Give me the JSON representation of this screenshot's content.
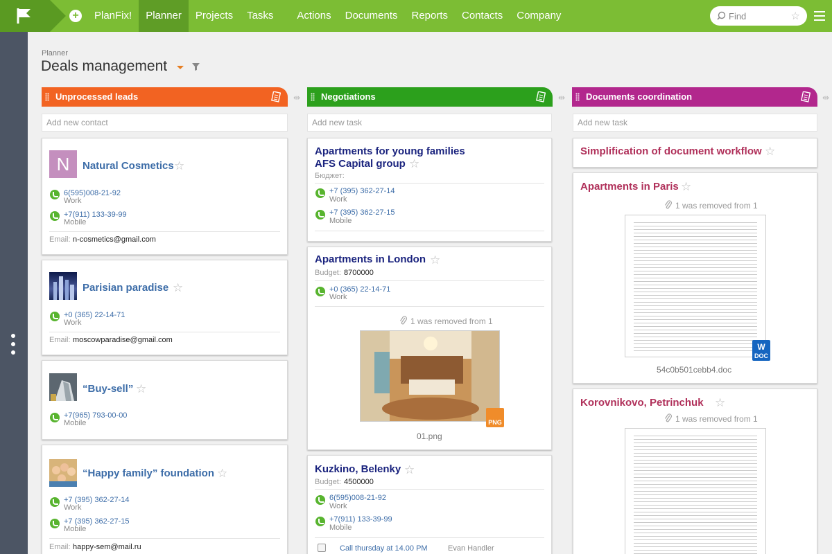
{
  "app": {
    "name": "PlanFix!"
  },
  "nav": [
    "Planner",
    "Projects",
    "Tasks",
    "Actions",
    "Documents",
    "Reports",
    "Contacts",
    "Company"
  ],
  "search": {
    "placeholder": "Find"
  },
  "page": {
    "breadcrumb": "Planner",
    "title": "Deals management"
  },
  "columns": [
    {
      "title": "Unprocessed leads",
      "color": "#f26322",
      "add_placeholder": "Add new contact"
    },
    {
      "title": "Negotiations",
      "color": "#2ca01c",
      "add_placeholder": "Add new task"
    },
    {
      "title": "Documents coordination",
      "color": "#b2278d",
      "add_placeholder": "Add new task"
    }
  ],
  "leads": [
    {
      "title": "Natural Cosmetics",
      "avatar_letter": "N",
      "phones": [
        {
          "number": "6(595)008-21-92",
          "type": "Work"
        },
        {
          "number": "+7(911) 133-39-99",
          "type": "Mobile"
        }
      ],
      "email_label": "Email:",
      "email": "n-cosmetics@gmail.com"
    },
    {
      "title": "Parisian paradise",
      "phones": [
        {
          "number": "+0 (365) 22-14-71",
          "type": "Work"
        }
      ],
      "email_label": "Email:",
      "email": "moscowparadise@gmail.com"
    },
    {
      "title": "“Buy-sell”",
      "phones": [
        {
          "number": "+7(965) 793-00-00",
          "type": "Mobile"
        }
      ]
    },
    {
      "title": "“Happy family” foundation",
      "phones": [
        {
          "number": "+7 (395) 362-27-14",
          "type": "Work"
        },
        {
          "number": "+7 (395) 362-27-15",
          "type": "Mobile"
        }
      ],
      "email_label": "Email:",
      "email": "happy-sem@mail.ru"
    }
  ],
  "negotiations": [
    {
      "title_line1": "Apartments for young families",
      "title_line2": "AFS Capital group",
      "budget_label": "Бюджет:",
      "phones": [
        {
          "number": "+7 (395) 362-27-14",
          "type": "Work"
        },
        {
          "number": "+7 (395) 362-27-15",
          "type": "Mobile"
        }
      ]
    },
    {
      "title": "Apartments in London",
      "budget_label": "Budget:",
      "budget": "8700000",
      "phones": [
        {
          "number": "+0 (365) 22-14-71",
          "type": "Work"
        }
      ],
      "attachment": {
        "removed_text": "1 was removed from 1",
        "file_name": "01.png",
        "badge": "PNG"
      }
    },
    {
      "title": "Kuzkino, Belenky",
      "budget_label": "Budget:",
      "budget": "4500000",
      "phones": [
        {
          "number": "6(595)008-21-92",
          "type": "Work"
        },
        {
          "number": "+7(911) 133-39-99",
          "type": "Mobile"
        }
      ],
      "task": {
        "text": "Call thursday at 14.00 PM",
        "assignee": "Evan Handler"
      }
    }
  ],
  "documents": [
    {
      "title": "Simplification of document workflow"
    },
    {
      "title": "Apartments in Paris",
      "attachment": {
        "removed_text": "1 was removed from 1",
        "file_name": "54c0b501cebb4.doc",
        "badge": "DOC"
      }
    },
    {
      "title": "Korovnikovo, Petrinchuk",
      "attachment": {
        "removed_text": "1 was removed from 1"
      }
    }
  ]
}
